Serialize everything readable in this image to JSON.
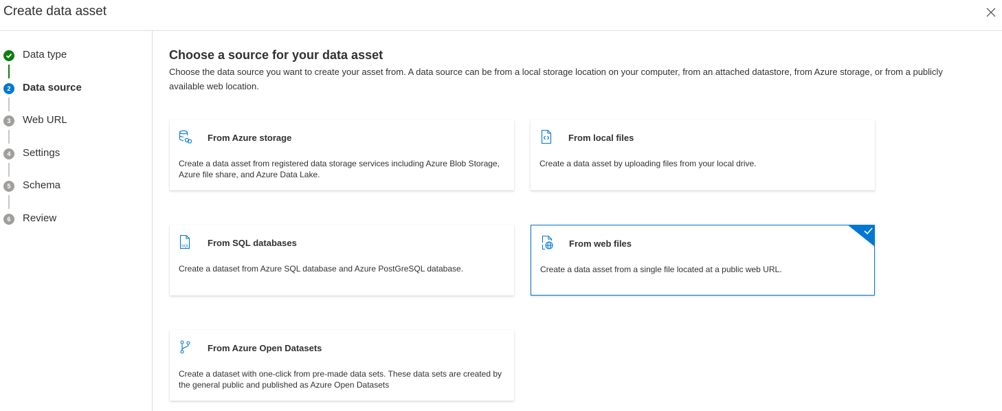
{
  "header": {
    "title": "Create data asset"
  },
  "steps": [
    {
      "label": "Data type",
      "number": "1",
      "state": "done"
    },
    {
      "label": "Data source",
      "number": "2",
      "state": "active"
    },
    {
      "label": "Web URL",
      "number": "3",
      "state": "todo"
    },
    {
      "label": "Settings",
      "number": "4",
      "state": "todo"
    },
    {
      "label": "Schema",
      "number": "5",
      "state": "todo"
    },
    {
      "label": "Review",
      "number": "6",
      "state": "todo"
    }
  ],
  "main": {
    "title": "Choose a source for your data asset",
    "description": "Choose the data source you want to create your asset from. A data source can be from a local storage location on your computer, from an attached datastore, from Azure storage, or from a publicly available web location."
  },
  "cards": [
    {
      "title": "From Azure storage",
      "description": "Create a data asset from registered data storage services including Azure Blob Storage, Azure file share, and Azure Data Lake.",
      "icon": "database-link-icon",
      "selected": false
    },
    {
      "title": "From local files",
      "description": "Create a data asset by uploading files from your local drive.",
      "icon": "code-file-icon",
      "selected": false
    },
    {
      "title": "From SQL databases",
      "description": "Create a dataset from Azure SQL database and Azure PostGreSQL database.",
      "icon": "sql-file-icon",
      "selected": false
    },
    {
      "title": "From web files",
      "description": "Create a data asset from a single file located at a public web URL.",
      "icon": "globe-file-icon",
      "selected": true
    },
    {
      "title": "From Azure Open Datasets",
      "description": "Create a dataset with one-click from pre-made data sets. These data sets are created by the general public and published as Azure Open Datasets",
      "icon": "branch-icon",
      "selected": false
    }
  ],
  "colors": {
    "accent": "#0078d4",
    "success": "#107c10",
    "inactive": "#a19f9d"
  }
}
